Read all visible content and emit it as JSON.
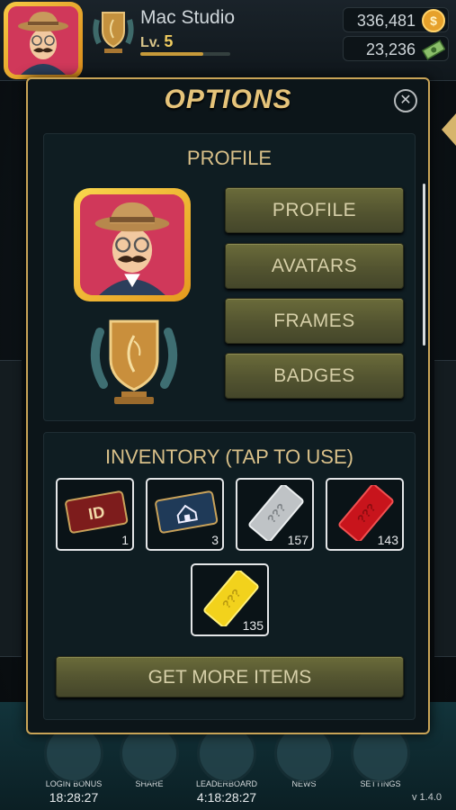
{
  "player": {
    "name": "Mac Studio",
    "level_prefix": "Lv.",
    "level": "5",
    "xp_progress": 0.7,
    "coins": "336,481",
    "cash": "23,236"
  },
  "modal": {
    "title": "OPTIONS",
    "close_glyph": "✕",
    "profile_section": {
      "heading": "PROFILE",
      "buttons": [
        "PROFILE",
        "AVATARS",
        "FRAMES",
        "BADGES"
      ]
    },
    "inventory_section": {
      "heading": "INVENTORY (TAP TO USE)",
      "items": [
        {
          "icon": "id-card-icon",
          "count": "1"
        },
        {
          "icon": "house-card-icon",
          "count": "3"
        },
        {
          "icon": "silver-mystery-card-icon",
          "count": "157"
        },
        {
          "icon": "red-mystery-card-icon",
          "count": "143"
        },
        {
          "icon": "gold-mystery-card-icon",
          "count": "135"
        }
      ],
      "id_card_text": "ID",
      "mystery_text": "???",
      "get_more_label": "GET MORE ITEMS"
    }
  },
  "bottom_nav": {
    "items": [
      {
        "label": "LOGIN BONUS",
        "timer": "18:28:27"
      },
      {
        "label": "SHARE",
        "timer": ""
      },
      {
        "label": "LEADERBOARD",
        "timer": "4:18:28:27"
      },
      {
        "label": "NEWS",
        "timer": ""
      },
      {
        "label": "SETTINGS",
        "timer": ""
      }
    ],
    "version": "v 1.4.0"
  },
  "colors": {
    "accent_gold": "#c9a457",
    "button_olive": "#535430",
    "avatar_bg": "#d0385a"
  }
}
